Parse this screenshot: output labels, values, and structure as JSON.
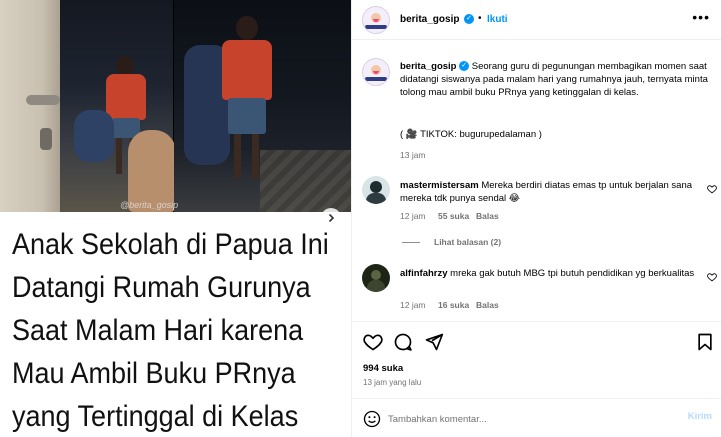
{
  "media": {
    "watermark": "@berita_gosip",
    "caption_lines": [
      "Anak Sekolah di Papua Ini",
      "Datangi Rumah Gurunya",
      "Saat Malam Hari karena",
      "Mau Ambil Buku PRnya",
      "yang Tertinggal di Kelas"
    ],
    "next_icon": "chevron-right-icon"
  },
  "header": {
    "username": "berita_gosip",
    "separator": "•",
    "follow_label": "Ikuti",
    "more_icon": "more-horizontal-icon",
    "verified_icon": "verified-badge-icon"
  },
  "post": {
    "username": "berita_gosip",
    "caption": "Seorang guru di pegunungan membagikan momen saat didatangi siswanya pada malam hari yang rumahnya jauh, ternyata minta tolong mau ambil buku PRnya yang ketinggalan di kelas.",
    "source": "( 🎥 TIKTOK: bugurupedalaman )",
    "time": "13 jam"
  },
  "comments": [
    {
      "username": "mastermistersam",
      "text": "Mereka berdiri diatas emas tp untuk berjalan sana mereka tdk punya sendal 😂",
      "time": "12 jam",
      "likes": "55 suka",
      "reply_label": "Balas",
      "view_replies": "Lihat balasan (2)"
    },
    {
      "username": "alfinfahrzy",
      "text": "mreka gak butuh MBG tpi butuh pendidikan yg berkualitas",
      "time": "12 jam",
      "likes": "16 suka",
      "reply_label": "Balas"
    }
  ],
  "actions": {
    "likes": "994 suka",
    "posted_ago": "13 jam yang lalu"
  },
  "comment_box": {
    "placeholder": "Tambahkan komentar...",
    "post_label": "Kirim"
  },
  "colors": {
    "accent": "#0095f6",
    "muted": "#737373",
    "post_disabled": "#b3dbff"
  }
}
